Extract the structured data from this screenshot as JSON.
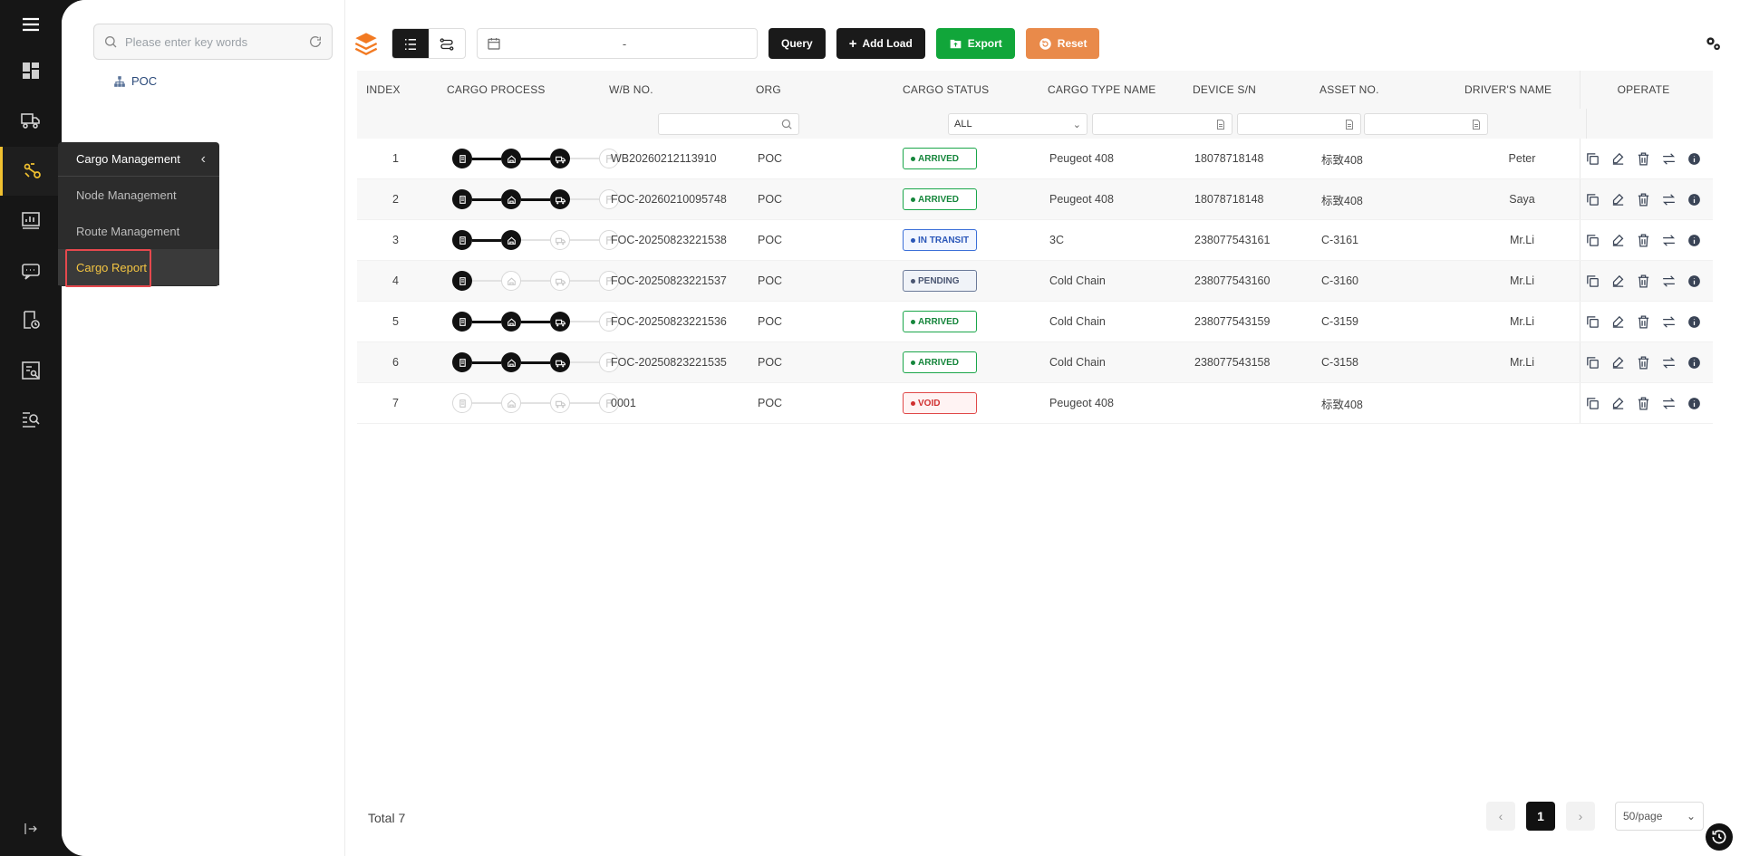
{
  "search": {
    "placeholder": "Please enter key words"
  },
  "tree": {
    "root_label": "POC"
  },
  "flyout": {
    "title": "Cargo Management",
    "items": [
      "Node Management",
      "Route Management",
      "Cargo Report"
    ],
    "selected_index": 2
  },
  "toolbar": {
    "date_separator": "-",
    "query_label": "Query",
    "add_label": "Add Load",
    "export_label": "Export",
    "reset_label": "Reset"
  },
  "table": {
    "headers": {
      "index": "INDEX",
      "process": "CARGO PROCESS",
      "wb": "W/B NO.",
      "org": "ORG",
      "status": "CARGO STATUS",
      "ctype": "CARGO TYPE NAME",
      "device": "DEVICE S/N",
      "asset": "ASSET NO.",
      "driver": "DRIVER'S NAME",
      "operate": "OPERATE"
    },
    "status_filter": "ALL",
    "rows": [
      {
        "index": "1",
        "steps": 3,
        "wb": "WB20260212113910",
        "org": "POC",
        "status": "ARRIVED",
        "status_kind": "arrived",
        "ctype": "Peugeot 408",
        "device": "18078718148",
        "asset": "标致408",
        "driver": "Peter"
      },
      {
        "index": "2",
        "steps": 3,
        "wb": "FOC-20260210095748",
        "org": "POC",
        "status": "ARRIVED",
        "status_kind": "arrived",
        "ctype": "Peugeot 408",
        "device": "18078718148",
        "asset": "标致408",
        "driver": "Saya"
      },
      {
        "index": "3",
        "steps": 2,
        "wb": "FOC-20250823221538",
        "org": "POC",
        "status": "IN TRANSIT",
        "status_kind": "transit",
        "ctype": "3C",
        "device": "238077543161",
        "asset": "C-3161",
        "driver": "Mr.Li"
      },
      {
        "index": "4",
        "steps": 1,
        "wb": "FOC-20250823221537",
        "org": "POC",
        "status": "PENDING",
        "status_kind": "pending",
        "ctype": "Cold Chain",
        "device": "238077543160",
        "asset": "C-3160",
        "driver": "Mr.Li"
      },
      {
        "index": "5",
        "steps": 3,
        "wb": "FOC-20250823221536",
        "org": "POC",
        "status": "ARRIVED",
        "status_kind": "arrived",
        "ctype": "Cold Chain",
        "device": "238077543159",
        "asset": "C-3159",
        "driver": "Mr.Li"
      },
      {
        "index": "6",
        "steps": 3,
        "wb": "FOC-20250823221535",
        "org": "POC",
        "status": "ARRIVED",
        "status_kind": "arrived",
        "ctype": "Cold Chain",
        "device": "238077543158",
        "asset": "C-3158",
        "driver": "Mr.Li"
      },
      {
        "index": "7",
        "steps": 0,
        "wb": "0001",
        "org": "POC",
        "status": "VOID",
        "status_kind": "void",
        "ctype": "Peugeot 408",
        "device": "",
        "asset": "标致408",
        "driver": ""
      }
    ]
  },
  "footer": {
    "total_label": "Total 7",
    "current_page": "1",
    "page_size": "50/page",
    "prev": "‹",
    "next": "›"
  },
  "icons": {
    "rail": [
      "menu-icon",
      "dashboard-icon",
      "truck-icon",
      "cargo-route-icon",
      "monitor-chart-icon",
      "message-icon",
      "schedule-icon",
      "report-icon",
      "search-list-icon",
      "logout-icon"
    ],
    "operate": [
      "copy-icon",
      "edit-icon",
      "delete-icon",
      "transfer-icon",
      "info-icon"
    ]
  },
  "colors": {
    "accent": "#f0c030",
    "orange": "#e98a4a",
    "green": "#11a63a"
  }
}
